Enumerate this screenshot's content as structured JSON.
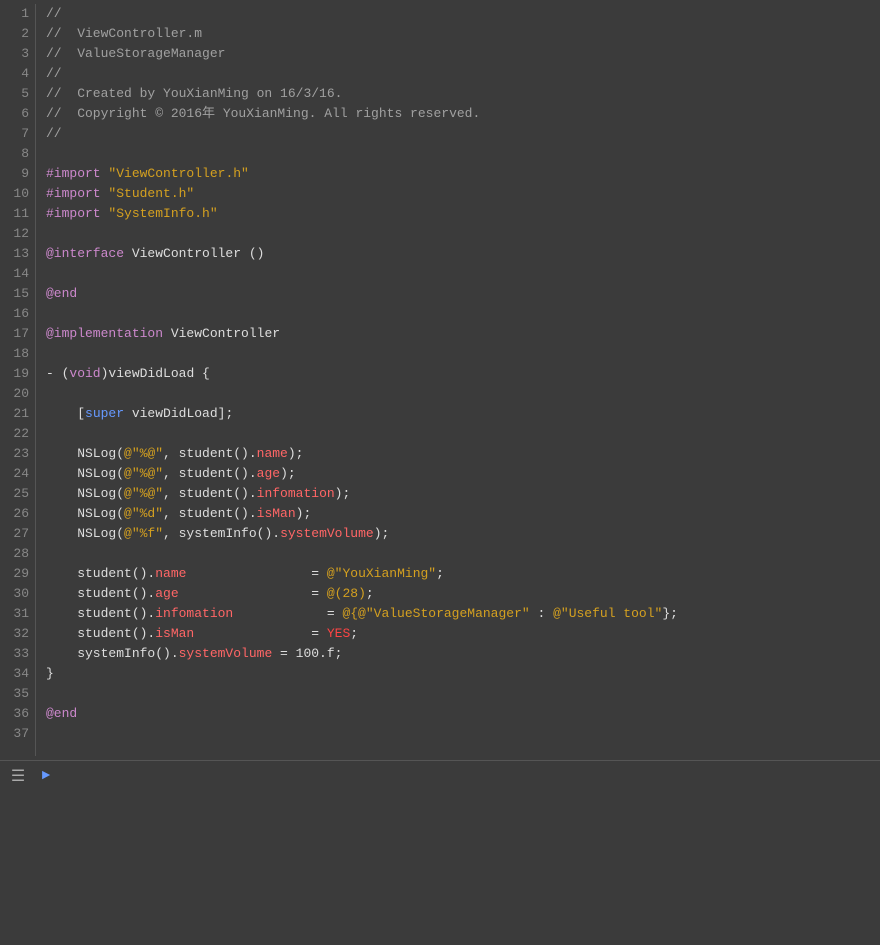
{
  "editor": {
    "background": "#3b3b3b",
    "lines": [
      {
        "num": 1,
        "tokens": [
          {
            "text": "//",
            "cls": "c-comment"
          }
        ]
      },
      {
        "num": 2,
        "tokens": [
          {
            "text": "//  ViewController.m",
            "cls": "c-comment"
          }
        ]
      },
      {
        "num": 3,
        "tokens": [
          {
            "text": "//  ValueStorageManager",
            "cls": "c-comment"
          }
        ]
      },
      {
        "num": 4,
        "tokens": [
          {
            "text": "//",
            "cls": "c-comment"
          }
        ]
      },
      {
        "num": 5,
        "tokens": [
          {
            "text": "//  Created by YouXianMing on 16/3/16.",
            "cls": "c-comment"
          }
        ]
      },
      {
        "num": 6,
        "tokens": [
          {
            "text": "//  Copyright © 2016年 YouXianMing. All rights reserved.",
            "cls": "c-comment"
          }
        ]
      },
      {
        "num": 7,
        "tokens": [
          {
            "text": "//",
            "cls": "c-comment"
          }
        ]
      },
      {
        "num": 8,
        "tokens": []
      },
      {
        "num": 9,
        "tokens": [
          {
            "text": "#import",
            "cls": "c-import-kw"
          },
          {
            "text": " ",
            "cls": "c-normal"
          },
          {
            "text": "\"ViewController.h\"",
            "cls": "c-format"
          }
        ]
      },
      {
        "num": 10,
        "tokens": [
          {
            "text": "#import",
            "cls": "c-import-kw"
          },
          {
            "text": " ",
            "cls": "c-normal"
          },
          {
            "text": "\"Student.h\"",
            "cls": "c-format"
          }
        ]
      },
      {
        "num": 11,
        "tokens": [
          {
            "text": "#import",
            "cls": "c-import-kw"
          },
          {
            "text": " ",
            "cls": "c-normal"
          },
          {
            "text": "\"SystemInfo.h\"",
            "cls": "c-format"
          }
        ]
      },
      {
        "num": 12,
        "tokens": []
      },
      {
        "num": 13,
        "tokens": [
          {
            "text": "@interface",
            "cls": "c-keyword"
          },
          {
            "text": " ViewController ()",
            "cls": "c-normal"
          }
        ]
      },
      {
        "num": 14,
        "tokens": []
      },
      {
        "num": 15,
        "tokens": [
          {
            "text": "@end",
            "cls": "c-keyword"
          }
        ]
      },
      {
        "num": 16,
        "tokens": []
      },
      {
        "num": 17,
        "tokens": [
          {
            "text": "@implementation",
            "cls": "c-keyword"
          },
          {
            "text": " ViewController",
            "cls": "c-normal"
          }
        ]
      },
      {
        "num": 18,
        "tokens": []
      },
      {
        "num": 19,
        "tokens": [
          {
            "text": "- (",
            "cls": "c-normal"
          },
          {
            "text": "void",
            "cls": "c-keyword"
          },
          {
            "text": ")viewDidLoad {",
            "cls": "c-normal"
          }
        ]
      },
      {
        "num": 20,
        "tokens": []
      },
      {
        "num": 21,
        "tokens": [
          {
            "text": "    [",
            "cls": "c-normal"
          },
          {
            "text": "super",
            "cls": "c-super"
          },
          {
            "text": " viewDidLoad];",
            "cls": "c-normal"
          }
        ]
      },
      {
        "num": 22,
        "tokens": []
      },
      {
        "num": 23,
        "tokens": [
          {
            "text": "    NSLog(",
            "cls": "c-normal"
          },
          {
            "text": "@\"%@\"",
            "cls": "c-format"
          },
          {
            "text": ", student().",
            "cls": "c-normal"
          },
          {
            "text": "name",
            "cls": "c-property"
          },
          {
            "text": ");",
            "cls": "c-normal"
          }
        ]
      },
      {
        "num": 24,
        "tokens": [
          {
            "text": "    NSLog(",
            "cls": "c-normal"
          },
          {
            "text": "@\"%@\"",
            "cls": "c-format"
          },
          {
            "text": ", student().",
            "cls": "c-normal"
          },
          {
            "text": "age",
            "cls": "c-property"
          },
          {
            "text": ");",
            "cls": "c-normal"
          }
        ]
      },
      {
        "num": 25,
        "tokens": [
          {
            "text": "    NSLog(",
            "cls": "c-normal"
          },
          {
            "text": "@\"%@\"",
            "cls": "c-format"
          },
          {
            "text": ", student().",
            "cls": "c-normal"
          },
          {
            "text": "infomation",
            "cls": "c-property"
          },
          {
            "text": ");",
            "cls": "c-normal"
          }
        ]
      },
      {
        "num": 26,
        "tokens": [
          {
            "text": "    NSLog(",
            "cls": "c-normal"
          },
          {
            "text": "@\"%d\"",
            "cls": "c-format"
          },
          {
            "text": ", student().",
            "cls": "c-normal"
          },
          {
            "text": "isMan",
            "cls": "c-property"
          },
          {
            "text": ");",
            "cls": "c-normal"
          }
        ]
      },
      {
        "num": 27,
        "tokens": [
          {
            "text": "    NSLog(",
            "cls": "c-normal"
          },
          {
            "text": "@\"%f\"",
            "cls": "c-format"
          },
          {
            "text": ", systemInfo().",
            "cls": "c-normal"
          },
          {
            "text": "systemVolume",
            "cls": "c-property"
          },
          {
            "text": ");",
            "cls": "c-normal"
          }
        ]
      },
      {
        "num": 28,
        "tokens": []
      },
      {
        "num": 29,
        "tokens": [
          {
            "text": "    student().",
            "cls": "c-normal"
          },
          {
            "text": "name",
            "cls": "c-property"
          },
          {
            "text": "                = ",
            "cls": "c-normal"
          },
          {
            "text": "@\"YouXianMing\"",
            "cls": "c-format"
          },
          {
            "text": ";",
            "cls": "c-normal"
          }
        ]
      },
      {
        "num": 30,
        "tokens": [
          {
            "text": "    student().",
            "cls": "c-normal"
          },
          {
            "text": "age",
            "cls": "c-property"
          },
          {
            "text": "                 = ",
            "cls": "c-normal"
          },
          {
            "text": "@(28)",
            "cls": "c-format"
          },
          {
            "text": ";",
            "cls": "c-normal"
          }
        ]
      },
      {
        "num": 31,
        "tokens": [
          {
            "text": "    student().",
            "cls": "c-normal"
          },
          {
            "text": "infomation",
            "cls": "c-property"
          },
          {
            "text": "            = ",
            "cls": "c-normal"
          },
          {
            "text": "@{@\"ValueStorageManager\"",
            "cls": "c-format"
          },
          {
            "text": " : ",
            "cls": "c-normal"
          },
          {
            "text": "@\"Useful tool\"",
            "cls": "c-format"
          },
          {
            "text": "};",
            "cls": "c-normal"
          }
        ]
      },
      {
        "num": 32,
        "tokens": [
          {
            "text": "    student().",
            "cls": "c-normal"
          },
          {
            "text": "isMan",
            "cls": "c-property"
          },
          {
            "text": "               = ",
            "cls": "c-normal"
          },
          {
            "text": "YES",
            "cls": "c-yes"
          },
          {
            "text": ";",
            "cls": "c-normal"
          }
        ]
      },
      {
        "num": 33,
        "tokens": [
          {
            "text": "    systemInfo().",
            "cls": "c-normal"
          },
          {
            "text": "systemVolume",
            "cls": "c-property"
          },
          {
            "text": " = 100.f;",
            "cls": "c-normal"
          }
        ]
      },
      {
        "num": 34,
        "tokens": [
          {
            "text": "}",
            "cls": "c-normal"
          }
        ]
      },
      {
        "num": 35,
        "tokens": []
      },
      {
        "num": 36,
        "tokens": [
          {
            "text": "@end",
            "cls": "c-keyword"
          }
        ]
      },
      {
        "num": 37,
        "tokens": []
      }
    ]
  },
  "toolbar": {
    "icon1": "≡",
    "icon2": "▶"
  }
}
